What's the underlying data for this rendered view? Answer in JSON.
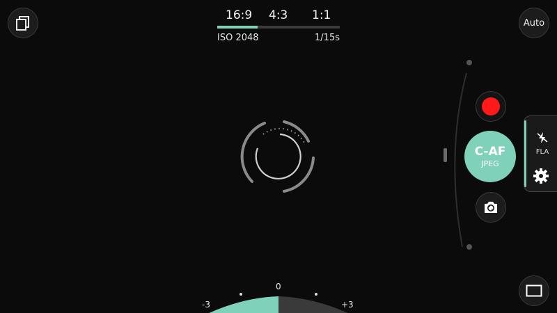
{
  "top_bar": {
    "aspect_ratios": [
      "16:9",
      "4:3",
      "1:1"
    ],
    "selected_ratio": "16:9",
    "iso": "ISO 2048",
    "shutter_speed": "1/15s"
  },
  "auto_button": {
    "label": "Auto"
  },
  "shutter_button": {
    "focus_mode": "C-AF",
    "format": "JPEG"
  },
  "side_panel": {
    "flash_label": "FLA"
  },
  "exposure": {
    "center": "0",
    "min": "-3",
    "max": "+3"
  },
  "colors": {
    "accent": "#7fd1b9",
    "record": "#ff1a1a",
    "background": "#0b0b0b"
  },
  "icons": {
    "gallery": "gallery-icon",
    "record": "record-icon",
    "switch_camera": "switch-camera-icon",
    "flash": "flash-off-icon",
    "settings": "gear-icon",
    "preview": "preview-frame-icon"
  }
}
